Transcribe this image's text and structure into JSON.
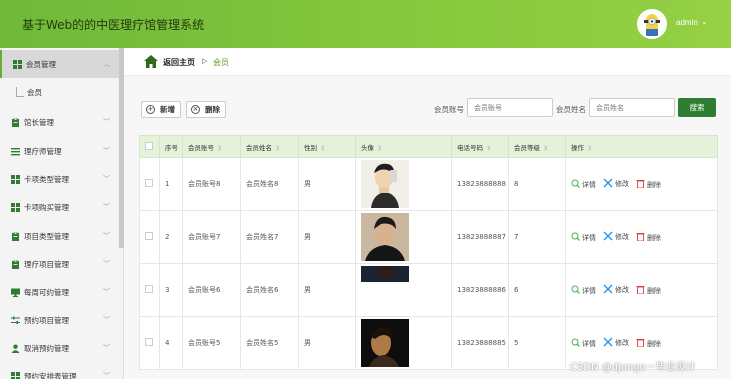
{
  "app": {
    "title": "基于Web的的中医理疗馆管理系统",
    "user": "admin",
    "caret": "⌄"
  },
  "sidebar": {
    "items": [
      {
        "label": "会员管理",
        "icon": "grid-icon",
        "color": "#2e7d32",
        "active": true
      },
      {
        "label": "馆长管理",
        "icon": "clipboard-icon",
        "color": "#2e7d32"
      },
      {
        "label": "理疗师管理",
        "icon": "list-icon",
        "color": "#2e7d32"
      },
      {
        "label": "卡项类型管理",
        "icon": "grid-icon",
        "color": "#2e7d32"
      },
      {
        "label": "卡项购买管理",
        "icon": "grid-icon",
        "color": "#2e7d32"
      },
      {
        "label": "项目类型管理",
        "icon": "clipboard-icon",
        "color": "#2e7d32"
      },
      {
        "label": "理疗项目管理",
        "icon": "clipboard-icon",
        "color": "#2e7d32"
      },
      {
        "label": "每周可约管理",
        "icon": "monitor-icon",
        "color": "#2e7d32"
      },
      {
        "label": "预约项目管理",
        "icon": "sliders-icon",
        "color": "#2e7d32"
      },
      {
        "label": "取消预约管理",
        "icon": "user-icon",
        "color": "#2e7d32"
      },
      {
        "label": "预约安排表管理",
        "icon": "grid-icon",
        "color": "#2e7d32"
      }
    ],
    "subitems": [
      {
        "label": "会员"
      }
    ]
  },
  "breadcrumb": {
    "home": "返回主页",
    "sep": "▷",
    "current": "会员"
  },
  "toolbar": {
    "add_label": "新增",
    "delete_label": "删除",
    "add_symbol": "+",
    "delete_symbol": "×"
  },
  "search": {
    "account_label": "会员账号",
    "account_placeholder": "会员账号",
    "name_label": "会员姓名",
    "name_placeholder": "会员姓名",
    "button": "搜索"
  },
  "table": {
    "headers": [
      "序号",
      "会员账号",
      "会员姓名",
      "性别",
      "头像",
      "电话号码",
      "会员等级",
      "操作"
    ],
    "sort_symbol": "⇕",
    "actions": {
      "detail": "详情",
      "edit": "修改",
      "delete": "删除"
    },
    "rows": [
      {
        "index": "1",
        "account": "会员账号8",
        "name": "会员姓名8",
        "gender": "男",
        "phone": "13823888888",
        "level": "8"
      },
      {
        "index": "2",
        "account": "会员账号7",
        "name": "会员姓名7",
        "gender": "男",
        "phone": "13823888887",
        "level": "7"
      },
      {
        "index": "3",
        "account": "会员账号6",
        "name": "会员姓名6",
        "gender": "男",
        "phone": "13823888886",
        "level": "6"
      },
      {
        "index": "4",
        "account": "会员账号5",
        "name": "会员姓名5",
        "gender": "男",
        "phone": "13823888885",
        "level": "5"
      }
    ]
  },
  "watermark": "CSDN @django－毕业设计",
  "colors": {
    "header": "#86c83d",
    "accent": "#5ba02f",
    "search_button": "#2e7d32",
    "table_header": "#e3f2d9",
    "detail_icon": "#4caf50",
    "edit_icon": "#2196f3",
    "delete_icon": "#e53935"
  }
}
